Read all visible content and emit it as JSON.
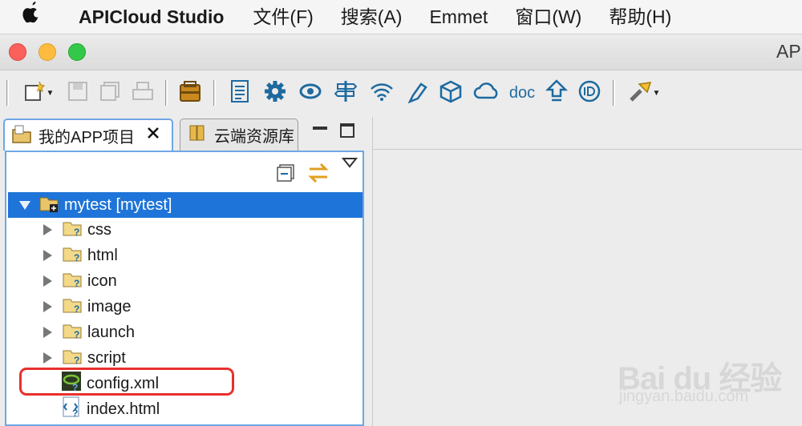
{
  "menubar": {
    "app_name": "APICloud Studio",
    "items": [
      "文件(F)",
      "搜索(A)",
      "Emmet",
      "窗口(W)",
      "帮助(H)"
    ]
  },
  "window": {
    "title": "AP"
  },
  "left_view": {
    "tabs": [
      {
        "label": "我的APP项目"
      },
      {
        "label": "云端资源库"
      }
    ]
  },
  "tree": {
    "root": "mytest [mytest]",
    "folders": [
      "css",
      "html",
      "icon",
      "image",
      "launch",
      "script"
    ],
    "files": [
      "config.xml",
      "index.html"
    ]
  },
  "toolbar": {
    "doc_label": "doc"
  },
  "watermark": {
    "brand": "Bai du 经验",
    "url": "jingyan.baidu.com"
  },
  "colors": {
    "selection": "#1e74d8",
    "highlight_box": "#e8302c",
    "active_tab_border": "#6ea7e4"
  }
}
